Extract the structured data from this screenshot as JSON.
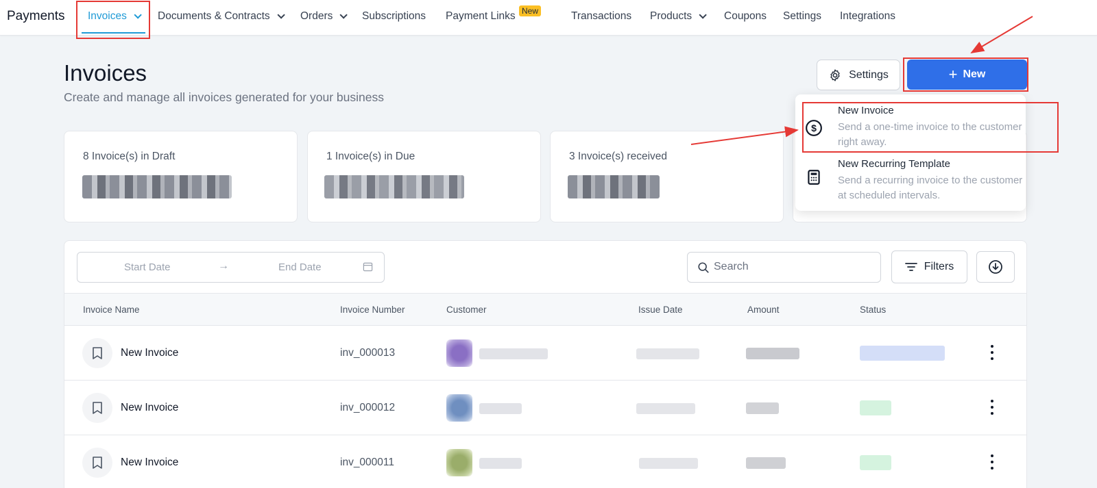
{
  "nav": {
    "brand": "Payments",
    "items": [
      {
        "label": "Invoices"
      },
      {
        "label": "Documents & Contracts"
      },
      {
        "label": "Orders"
      },
      {
        "label": "Subscriptions"
      },
      {
        "label": "Payment Links"
      },
      {
        "label": "Transactions"
      },
      {
        "label": "Products"
      },
      {
        "label": "Coupons"
      },
      {
        "label": "Settings"
      },
      {
        "label": "Integrations"
      }
    ],
    "new_badge": "New"
  },
  "header": {
    "title": "Invoices",
    "subtitle": "Create and manage all invoices generated for your business",
    "settings_label": "Settings",
    "new_label": "New"
  },
  "stats": [
    {
      "label": "8 Invoice(s) in Draft"
    },
    {
      "label": "1 Invoice(s) in Due"
    },
    {
      "label": "3 Invoice(s) received"
    }
  ],
  "dropdown": {
    "items": [
      {
        "title": "New Invoice",
        "desc": "Send a one-time invoice to the customer right away."
      },
      {
        "title": "New Recurring Template",
        "desc": "Send a recurring invoice to the customer at scheduled intervals."
      }
    ]
  },
  "toolbar": {
    "start_date": "Start Date",
    "end_date": "End Date",
    "arrow": "→",
    "search_placeholder": "Search",
    "filters_label": "Filters"
  },
  "table": {
    "headers": [
      "Invoice Name",
      "Invoice Number",
      "Customer",
      "Issue Date",
      "Amount",
      "Status"
    ],
    "rows": [
      {
        "name": "New Invoice",
        "number": "inv_000013"
      },
      {
        "name": "New Invoice",
        "number": "inv_000012"
      },
      {
        "name": "New Invoice",
        "number": "inv_000011"
      }
    ]
  },
  "colors": {
    "accent": "#1e9ad6",
    "primary_button": "#2f6fe8",
    "annotation": "#e53935",
    "badge": "#fbbf24"
  }
}
